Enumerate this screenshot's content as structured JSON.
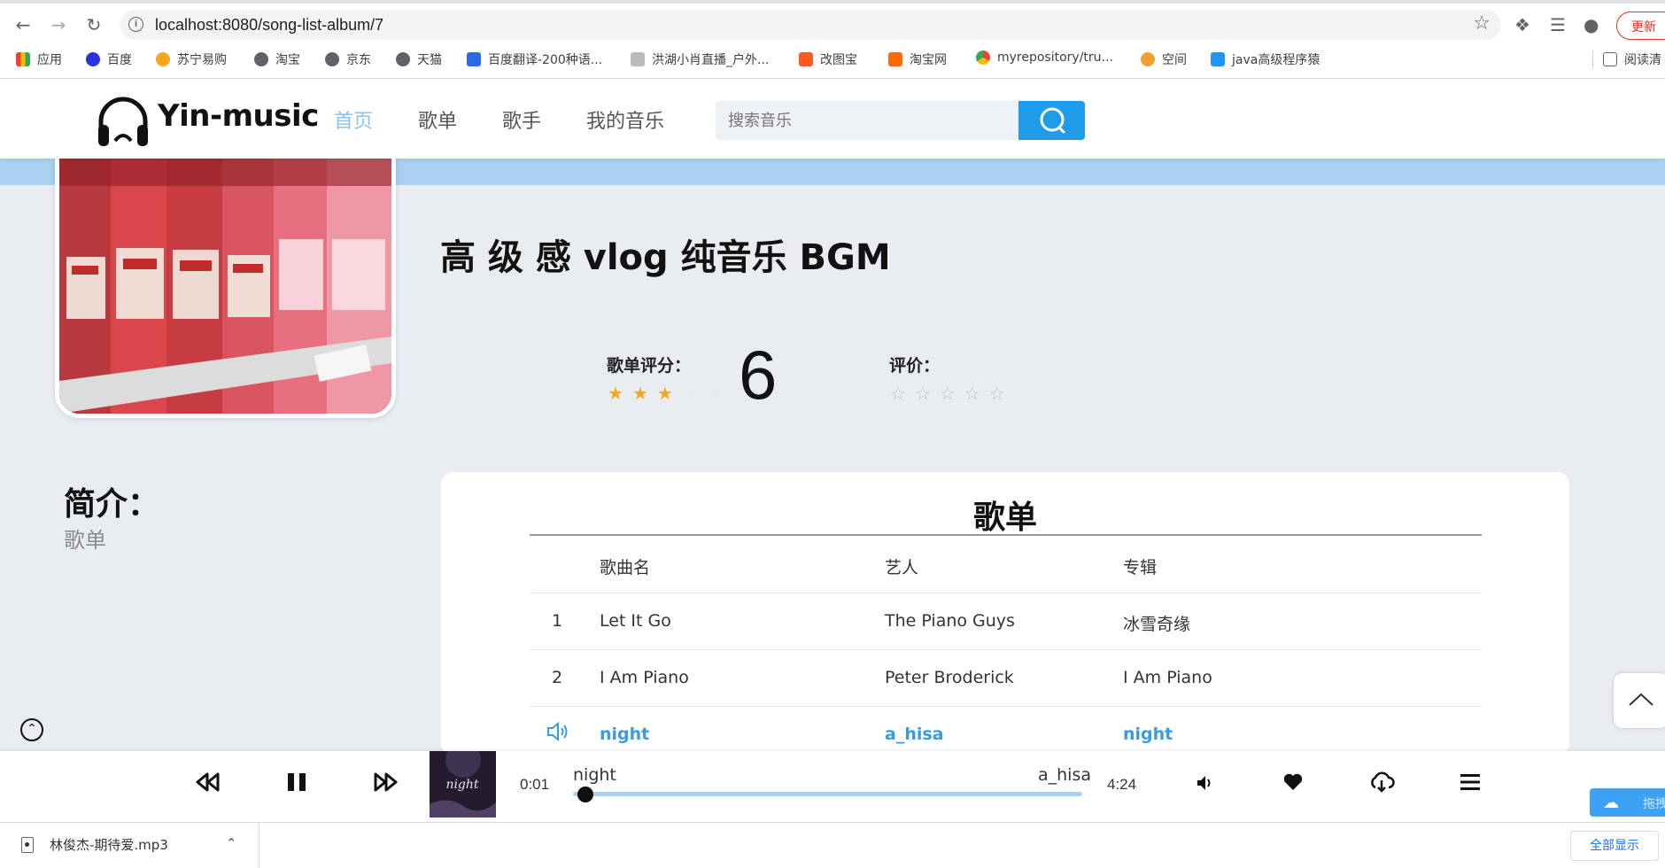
{
  "browser": {
    "url": "localhost:8080/song-list-album/7",
    "update_label": "更新",
    "bookmarks": [
      {
        "label": "应用",
        "color": "#4285f4"
      },
      {
        "label": "百度",
        "color": "#2932e1"
      },
      {
        "label": "苏宁易购",
        "color": "#f5a623"
      },
      {
        "label": "淘宝",
        "color": "#5f6368"
      },
      {
        "label": "京东",
        "color": "#5f6368"
      },
      {
        "label": "天猫",
        "color": "#5f6368"
      },
      {
        "label": "百度翻译-200种语...",
        "color": "#2a6ae9"
      },
      {
        "label": "洪湖小肖直播_户外...",
        "color": "#888888"
      },
      {
        "label": "改图宝",
        "color": "#ff5a1f"
      },
      {
        "label": "淘宝网",
        "color": "#ff6a00"
      },
      {
        "label": "myrepository/tru...",
        "color": "#e53935"
      },
      {
        "label": "空间",
        "color": "#f0a030"
      },
      {
        "label": "java高级程序猿",
        "color": "#2196f3"
      }
    ],
    "reading_mode": "阅读清"
  },
  "header": {
    "logo_text": "Yin-music",
    "nav": [
      "首页",
      "歌单",
      "歌手",
      "我的音乐"
    ],
    "active_nav": "首页",
    "search_placeholder": "搜索音乐"
  },
  "album": {
    "title": "高 级 感 vlog 纯音乐 BGM",
    "rating_label": "歌单评分：",
    "rating_stars_filled": 3,
    "rating_stars_total": 5,
    "score": "6",
    "review_label": "评价：",
    "review_stars_total": 5,
    "intro_title": "简介：",
    "intro_text": "歌单"
  },
  "songs": {
    "title": "歌单",
    "columns": [
      "歌曲名",
      "艺人",
      "专辑"
    ],
    "rows": [
      {
        "index": "1",
        "name": "Let It Go",
        "artist": "The Piano Guys",
        "album": "冰雪奇缘",
        "playing": false
      },
      {
        "index": "2",
        "name": "I Am Piano",
        "artist": "Peter Broderick",
        "album": "I Am Piano",
        "playing": false
      },
      {
        "index": "",
        "name": "night",
        "artist": "a_hisa",
        "album": "night",
        "playing": true
      }
    ]
  },
  "player": {
    "current_time": "0:01",
    "total_time": "4:24",
    "song": "night",
    "artist": "a_hisa",
    "cover_text": "night",
    "progress": 0.004
  },
  "baidu_badge": "拖拽",
  "download": {
    "file": "林俊杰-期待爱.mp3",
    "show_all": "全部显示"
  },
  "colors": {
    "accent_blue": "#1e9be9",
    "active_nav": "#88c3ec",
    "playing_row": "#3a9be0",
    "star_filled": "#f5a623"
  }
}
